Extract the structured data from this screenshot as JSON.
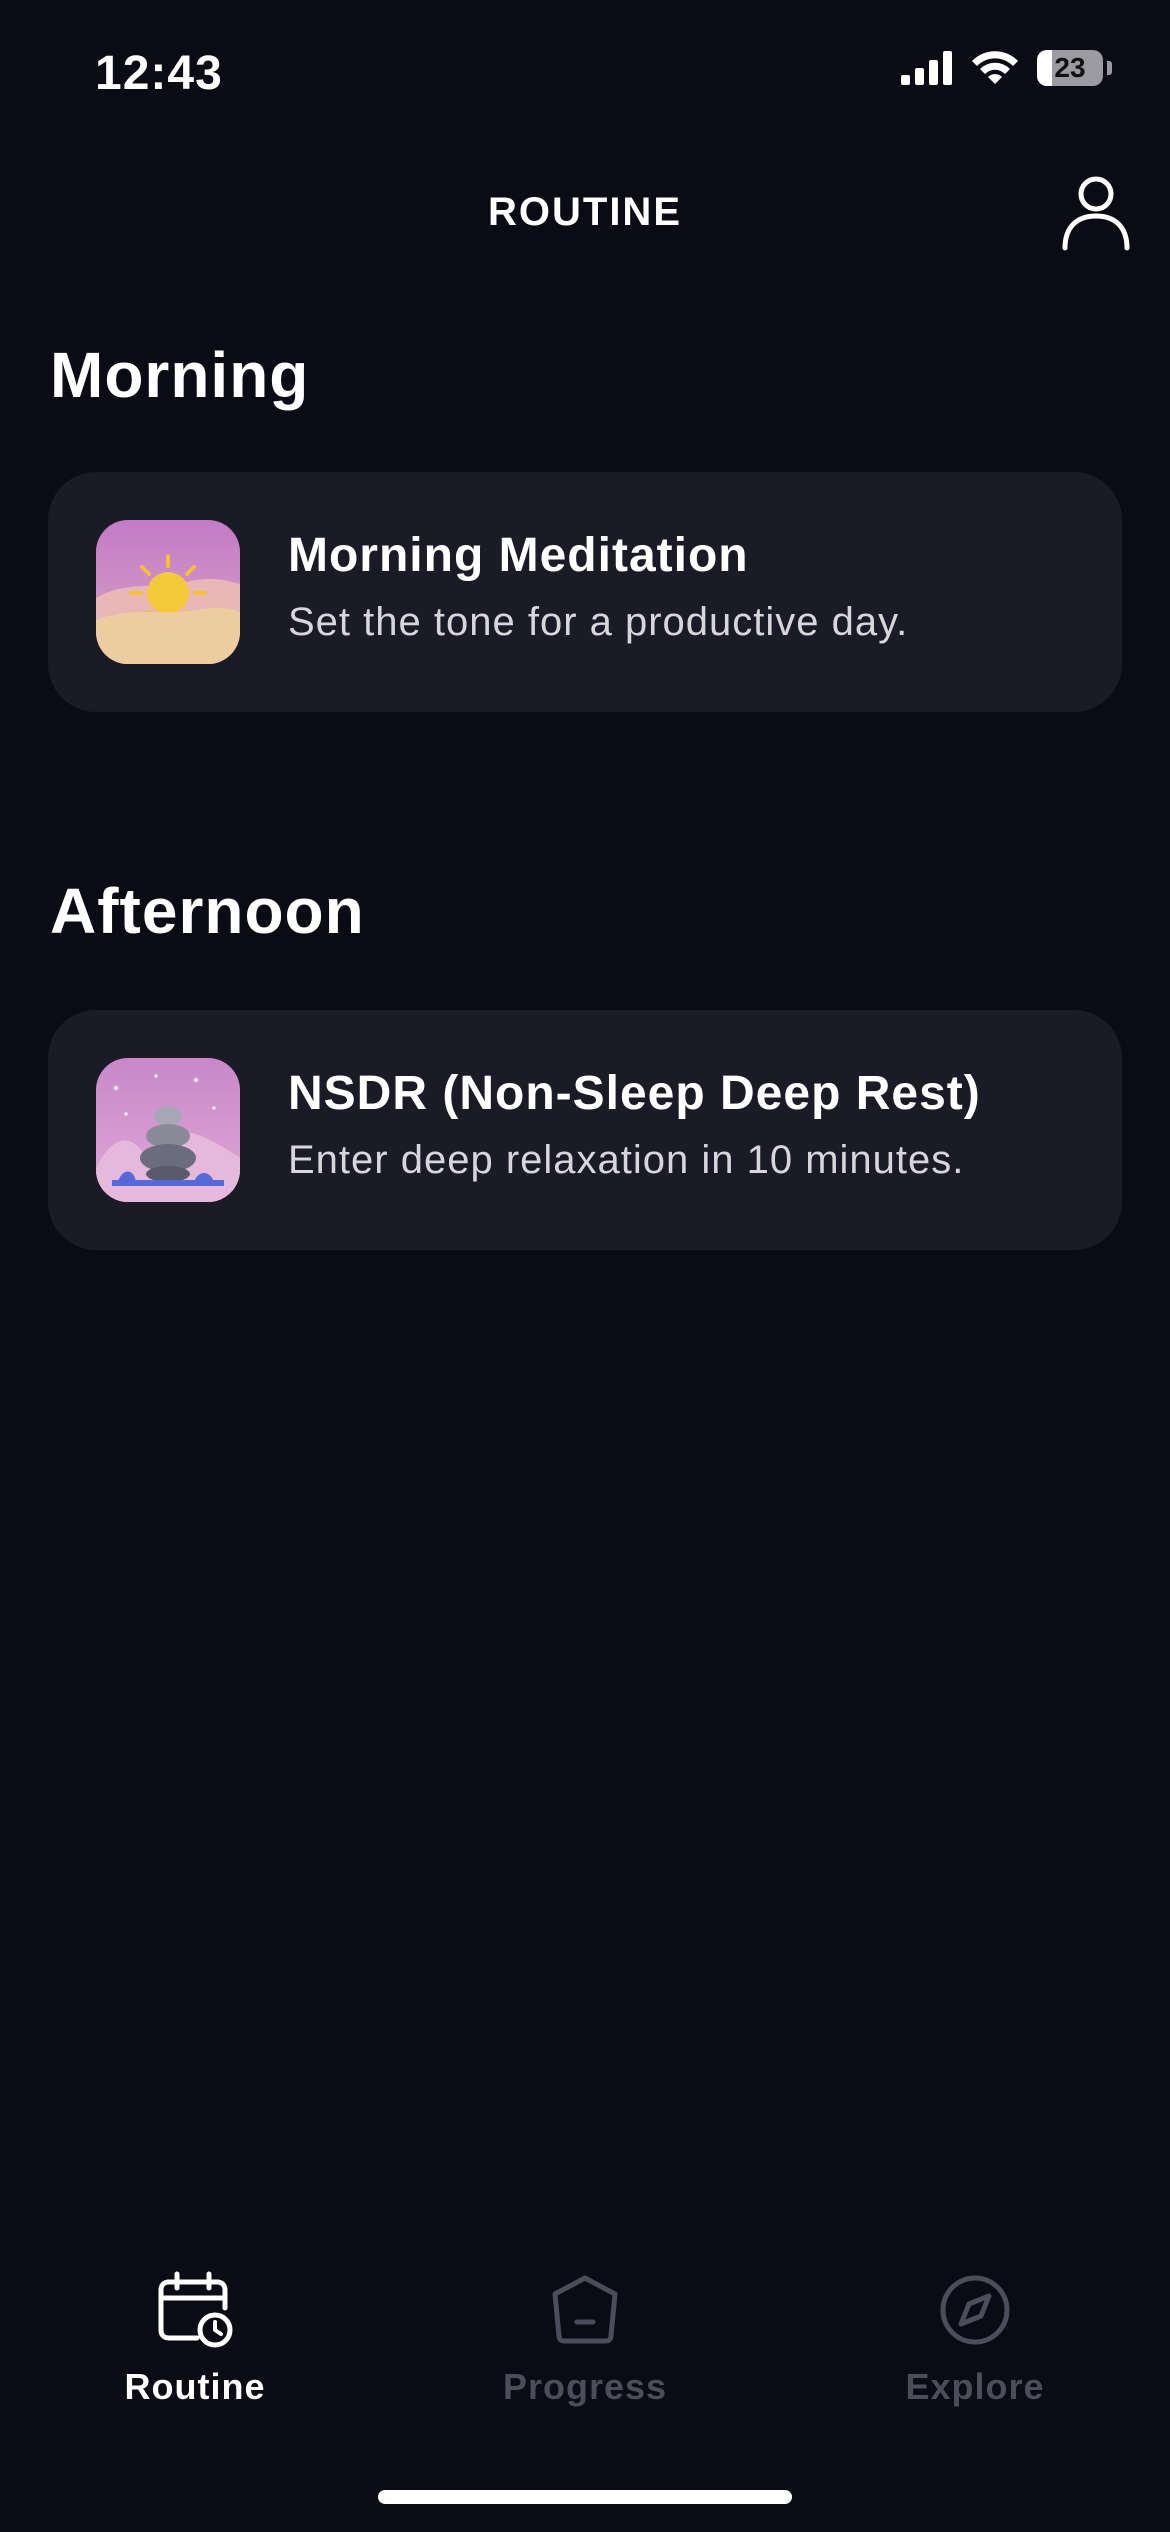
{
  "status_bar": {
    "time": "12:43",
    "battery_level": "23",
    "battery_fraction": 0.23,
    "signal_icon": "cellular-signal-icon",
    "wifi_icon": "wifi-icon"
  },
  "header": {
    "title": "ROUTINE",
    "profile_icon": "person-icon"
  },
  "sections": [
    {
      "title": "Morning",
      "items": [
        {
          "title": "Morning Meditation",
          "subtitle": "Set the tone for a productive day.",
          "thumbnail_icon": "sun-icon"
        }
      ]
    },
    {
      "title": "Afternoon",
      "items": [
        {
          "title": "NSDR (Non-Sleep Deep Rest)",
          "subtitle": "Enter deep relaxation in 10 minutes.",
          "thumbnail_icon": "stacked-stones-icon"
        }
      ]
    }
  ],
  "tab_bar": {
    "tabs": [
      {
        "label": "Routine",
        "icon": "calendar-clock-icon",
        "active": true
      },
      {
        "label": "Progress",
        "icon": "pentagon-icon",
        "active": false
      },
      {
        "label": "Explore",
        "icon": "compass-icon",
        "active": false
      }
    ]
  },
  "colors": {
    "background": "#0a0b14",
    "card": "#1a1b26",
    "text_primary": "#ffffff",
    "text_secondary": "#d6d6dc",
    "tab_inactive": "#4b4d5a"
  }
}
